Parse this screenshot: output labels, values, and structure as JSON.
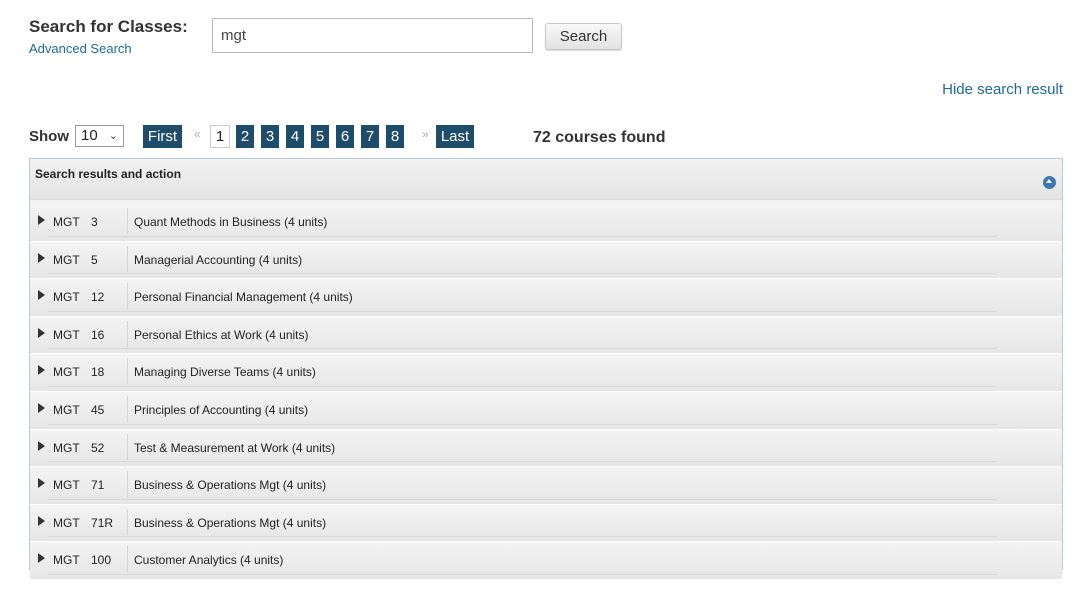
{
  "search": {
    "title": "Search for Classes:",
    "advanced_link": "Advanced Search",
    "query": "mgt",
    "button": "Search",
    "hide_link": "Hide search result"
  },
  "pagination": {
    "show_label": "Show",
    "page_size": "10",
    "first": "First",
    "prev": "«",
    "pages": [
      "1",
      "2",
      "3",
      "4",
      "5",
      "6",
      "7",
      "8"
    ],
    "current_page": "1",
    "next": "»",
    "last": "Last",
    "found": "72 courses found"
  },
  "results": {
    "header": "Search results and action",
    "collapse_icon": "circle-chevron-up-icon",
    "rows": [
      {
        "subject": "MGT",
        "number": "3",
        "title": "Quant Methods in Business (4 units)"
      },
      {
        "subject": "MGT",
        "number": "5",
        "title": "Managerial Accounting (4 units)"
      },
      {
        "subject": "MGT",
        "number": "12",
        "title": "Personal Financial Management (4 units)"
      },
      {
        "subject": "MGT",
        "number": "16",
        "title": "Personal Ethics at Work (4 units)"
      },
      {
        "subject": "MGT",
        "number": "18",
        "title": "Managing Diverse Teams (4 units)"
      },
      {
        "subject": "MGT",
        "number": "45",
        "title": "Principles of Accounting (4 units)"
      },
      {
        "subject": "MGT",
        "number": "52",
        "title": "Test & Measurement at Work (4 units)"
      },
      {
        "subject": "MGT",
        "number": "71",
        "title": "Business & Operations Mgt (4 units)"
      },
      {
        "subject": "MGT",
        "number": "71R",
        "title": "Business & Operations Mgt (4 units)"
      },
      {
        "subject": "MGT",
        "number": "100",
        "title": "Customer Analytics (4 units)"
      }
    ]
  },
  "colors": {
    "accent": "#1e4d6b",
    "link": "#1f6a9a"
  }
}
